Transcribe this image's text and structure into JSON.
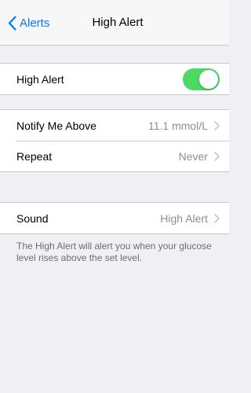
{
  "nav": {
    "back_label": "Alerts",
    "title": "High Alert"
  },
  "toggle_section": {
    "label": "High Alert",
    "enabled": true
  },
  "settings": [
    {
      "label": "Notify Me Above",
      "value": "11.1 mmol/L"
    },
    {
      "label": "Repeat",
      "value": "Never"
    }
  ],
  "sound": {
    "label": "Sound",
    "value": "High Alert"
  },
  "footer_note": "The High Alert will alert you when your glucose level rises above the set level.",
  "colors": {
    "accent": "#007aff",
    "toggle_on": "#4cd964",
    "background": "#efeff4",
    "secondary_text": "#8e8e93"
  },
  "icons": [
    "chevron-left-icon",
    "chevron-right-icon"
  ]
}
